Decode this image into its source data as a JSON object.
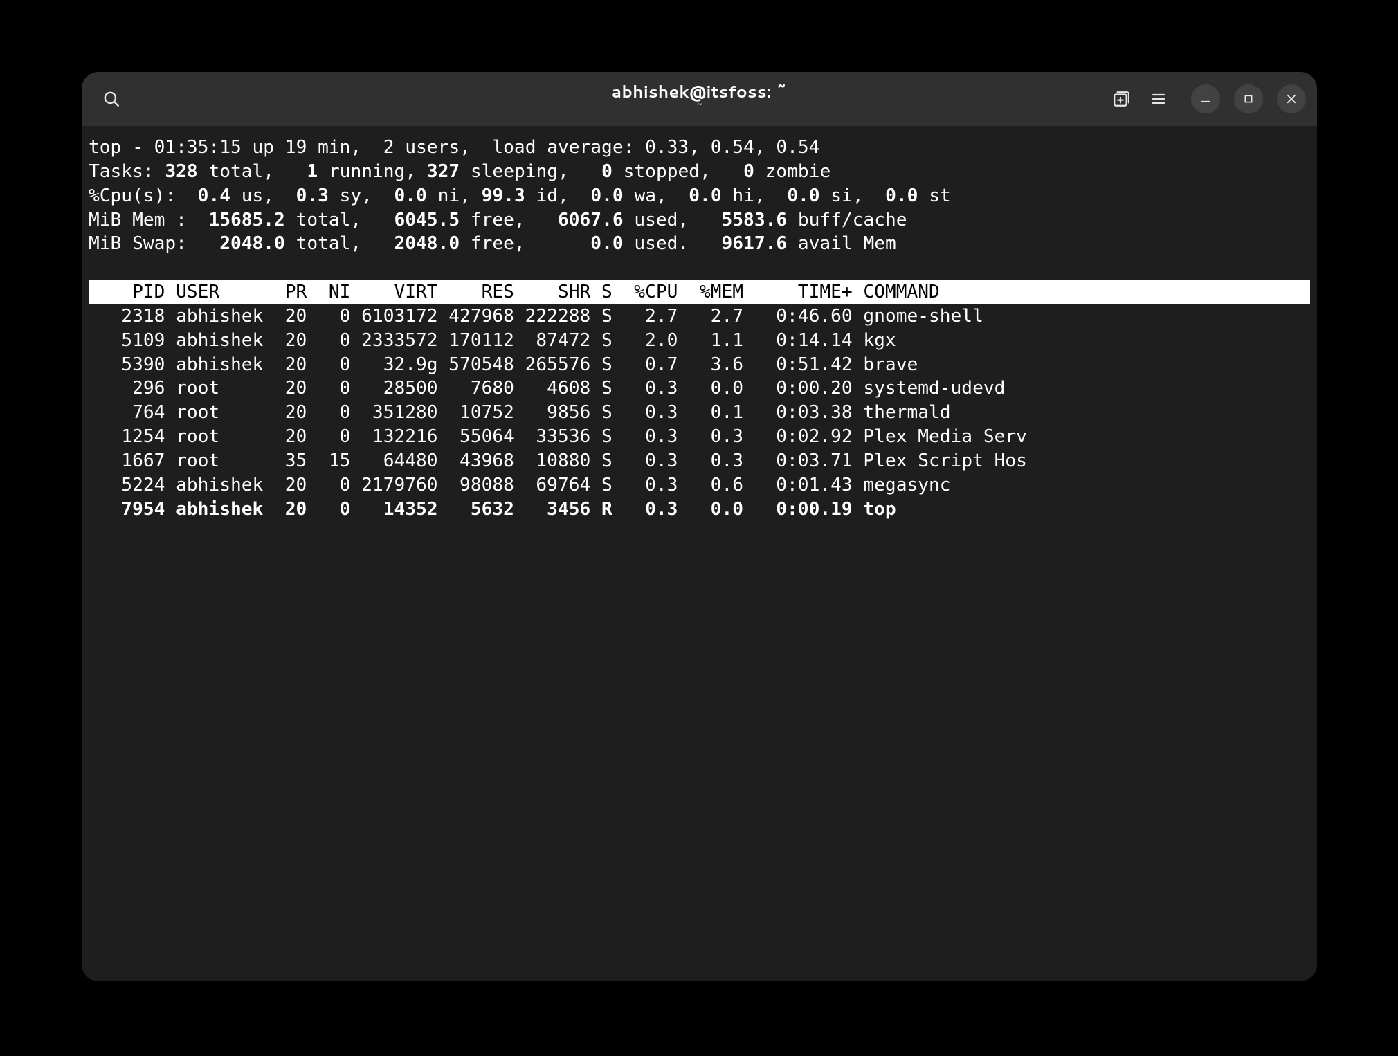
{
  "window": {
    "title_main": "abhishek@itsfoss: ~",
    "title_sub": "~"
  },
  "top": {
    "summary": {
      "line1_prefix": "top - ",
      "time": "01:35:15",
      "uptime": " up 19 min,  ",
      "users": "2 users,",
      "loadavg_label": "  load average: ",
      "loadavg": "0.33, 0.54, 0.54",
      "tasks_label": "Tasks: ",
      "tasks_total": "328",
      "tasks_total_suffix": " total,   ",
      "tasks_running": "1",
      "tasks_running_suffix": " running, ",
      "tasks_sleeping": "327",
      "tasks_sleeping_suffix": " sleeping,   ",
      "tasks_stopped": "0",
      "tasks_stopped_suffix": " stopped,   ",
      "tasks_zombie": "0",
      "tasks_zombie_suffix": " zombie",
      "cpu_label": "%Cpu(s):  ",
      "cpu_us": "0.4",
      "cpu_us_suffix": " us,  ",
      "cpu_sy": "0.3",
      "cpu_sy_suffix": " sy,  ",
      "cpu_ni": "0.0",
      "cpu_ni_suffix": " ni, ",
      "cpu_id": "99.3",
      "cpu_id_suffix": " id,  ",
      "cpu_wa": "0.0",
      "cpu_wa_suffix": " wa,  ",
      "cpu_hi": "0.0",
      "cpu_hi_suffix": " hi,  ",
      "cpu_si": "0.0",
      "cpu_si_suffix": " si,  ",
      "cpu_st": "0.0",
      "cpu_st_suffix": " st",
      "mem_label": "MiB Mem :  ",
      "mem_total": "15685.2",
      "mem_total_suffix": " total,   ",
      "mem_free": "6045.5",
      "mem_free_suffix": " free,   ",
      "mem_used": "6067.6",
      "mem_used_suffix": " used,   ",
      "mem_buff": "5583.6",
      "mem_buff_suffix": " buff/cache",
      "swap_label": "MiB Swap:   ",
      "swap_total": "2048.0",
      "swap_total_suffix": " total,   ",
      "swap_free": "2048.0",
      "swap_free_suffix": " free,      ",
      "swap_used": "0.0",
      "swap_used_suffix": " used.   ",
      "swap_avail": "9617.6",
      "swap_avail_suffix": " avail Mem"
    },
    "header": "    PID USER      PR  NI    VIRT    RES    SHR S  %CPU  %MEM     TIME+ COMMAND                                     ",
    "rows": [
      {
        "pid": "2318",
        "user": "abhishek",
        "pr": "20",
        "ni": "0",
        "virt": "6103172",
        "res": "427968",
        "shr": "222288",
        "s": "S",
        "cpu": "2.7",
        "mem": "2.7",
        "time": "0:46.60",
        "cmd": "gnome-shell",
        "bold": false
      },
      {
        "pid": "5109",
        "user": "abhishek",
        "pr": "20",
        "ni": "0",
        "virt": "2333572",
        "res": "170112",
        "shr": "87472",
        "s": "S",
        "cpu": "2.0",
        "mem": "1.1",
        "time": "0:14.14",
        "cmd": "kgx",
        "bold": false
      },
      {
        "pid": "5390",
        "user": "abhishek",
        "pr": "20",
        "ni": "0",
        "virt": "32.9g",
        "res": "570548",
        "shr": "265576",
        "s": "S",
        "cpu": "0.7",
        "mem": "3.6",
        "time": "0:51.42",
        "cmd": "brave",
        "bold": false
      },
      {
        "pid": "296",
        "user": "root",
        "pr": "20",
        "ni": "0",
        "virt": "28500",
        "res": "7680",
        "shr": "4608",
        "s": "S",
        "cpu": "0.3",
        "mem": "0.0",
        "time": "0:00.20",
        "cmd": "systemd-udevd",
        "bold": false
      },
      {
        "pid": "764",
        "user": "root",
        "pr": "20",
        "ni": "0",
        "virt": "351280",
        "res": "10752",
        "shr": "9856",
        "s": "S",
        "cpu": "0.3",
        "mem": "0.1",
        "time": "0:03.38",
        "cmd": "thermald",
        "bold": false
      },
      {
        "pid": "1254",
        "user": "root",
        "pr": "20",
        "ni": "0",
        "virt": "132216",
        "res": "55064",
        "shr": "33536",
        "s": "S",
        "cpu": "0.3",
        "mem": "0.3",
        "time": "0:02.92",
        "cmd": "Plex Media Serv",
        "bold": false
      },
      {
        "pid": "1667",
        "user": "root",
        "pr": "35",
        "ni": "15",
        "virt": "64480",
        "res": "43968",
        "shr": "10880",
        "s": "S",
        "cpu": "0.3",
        "mem": "0.3",
        "time": "0:03.71",
        "cmd": "Plex Script Hos",
        "bold": false
      },
      {
        "pid": "5224",
        "user": "abhishek",
        "pr": "20",
        "ni": "0",
        "virt": "2179760",
        "res": "98088",
        "shr": "69764",
        "s": "S",
        "cpu": "0.3",
        "mem": "0.6",
        "time": "0:01.43",
        "cmd": "megasync",
        "bold": false
      },
      {
        "pid": "7954",
        "user": "abhishek",
        "pr": "20",
        "ni": "0",
        "virt": "14352",
        "res": "5632",
        "shr": "3456",
        "s": "R",
        "cpu": "0.3",
        "mem": "0.0",
        "time": "0:00.19",
        "cmd": "top",
        "bold": true
      }
    ]
  }
}
